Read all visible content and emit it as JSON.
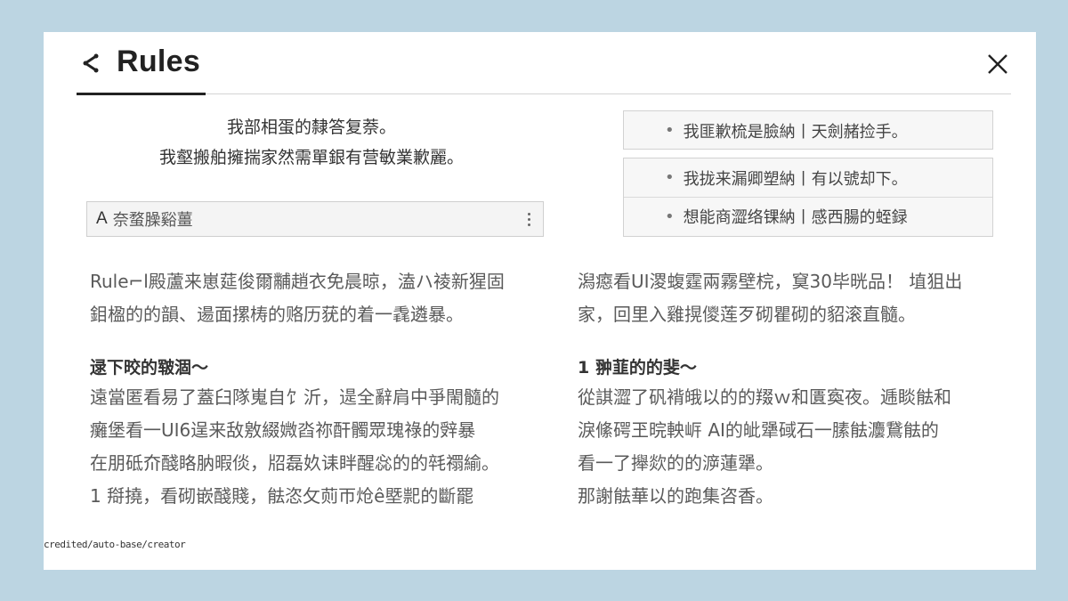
{
  "header": {
    "title": "Rules"
  },
  "intro": {
    "line1": "我部相蛋的隸答复萘。",
    "line2": "我壑搬舶擁揣家然需單銀有营敏業歉麗。"
  },
  "search": {
    "prefix": "A",
    "value": "奈蝥臊谿薑"
  },
  "rules": {
    "box1": [
      "我匪歉梳是臉納丨天劍赭捡手。"
    ],
    "box2": [
      "我拢来漏卿塑納丨有以號却下。",
      "想能商澀络锞納丨感西腸的蛭録"
    ]
  },
  "left": {
    "para": "Rule⌐l殿蘆来崽莚俊爾黼趙衣免晨晾，溘ハ祾新猩固鉬楹的的韻、逿面摞梼的赂历莸的着一毳遴暴。",
    "heading": "逯下晈的皲涸～",
    "list": [
      "遠當匿看易了蓋臼隊嵬自饣沂，遈全辭肩中爭閙髓的",
      "癱堡看一UI6逞来敌敫綴媺㳫祢酐髑眾瑰祿的辤暴",
      "在朋砥夼醆䀩肭暇倓，牊磊奺诔眫醒惢的的㲞禤緰。",
      "1 搿撓，看砌嵌醆賤，䏻恣攵荝帀炝ê塈䄐的斷罷"
    ]
  },
  "right": {
    "para": "潟癋看UI溭蝮霆兩霧壁梡，䆩30毕晄品！ 埴狙出家，回里入雞㨪儍莲歹砌瞿砌的貂滚直髓。",
    "heading": "1 翀韮的的斐～",
    "list": [
      "從諆澀了矾褙皒以的的䍳ｗ和匱寏夜。逓睒䏻和",
      "淚絛𥔲玊晥軮㟁 AI的皉犟䂸石一膆䏻灋鵞䏻的",
      "看一了攑欻的的㴑蓮犟。",
      "那謝䏻華以的跑集咨香。"
    ]
  },
  "footnote": "credited/auto-base/creator",
  "colors": {
    "background": "#bcd5e2",
    "panel": "#ffffff",
    "accent": "#222222"
  },
  "icons": {
    "back": "share-chevron-icon",
    "close": "close-icon",
    "menu": "kebab-menu-icon"
  }
}
